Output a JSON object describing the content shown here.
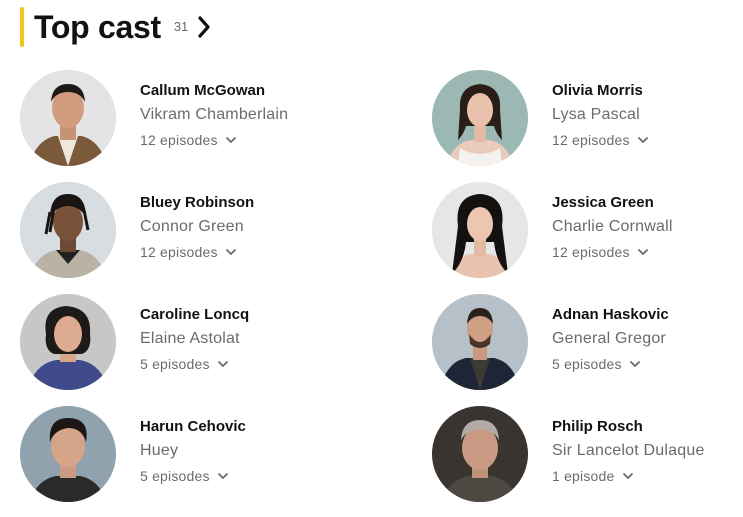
{
  "section": {
    "title": "Top cast",
    "count": "31"
  },
  "colors": {
    "accent": "#f5c518",
    "secondary_text": "#6b6b6b"
  },
  "cast": [
    {
      "actor": "Callum McGowan",
      "character": "Vikram Chamberlain",
      "episodes": "12 episodes"
    },
    {
      "actor": "Olivia Morris",
      "character": "Lysa Pascal",
      "episodes": "12 episodes"
    },
    {
      "actor": "Bluey Robinson",
      "character": "Connor Green",
      "episodes": "12 episodes"
    },
    {
      "actor": "Jessica Green",
      "character": "Charlie Cornwall",
      "episodes": "12 episodes"
    },
    {
      "actor": "Caroline Loncq",
      "character": "Elaine Astolat",
      "episodes": "5 episodes"
    },
    {
      "actor": "Adnan Haskovic",
      "character": "General Gregor",
      "episodes": "5 episodes"
    },
    {
      "actor": "Harun Cehovic",
      "character": "Huey",
      "episodes": "5 episodes"
    },
    {
      "actor": "Philip Rosch",
      "character": "Sir Lancelot Dulaque",
      "episodes": "1 episode"
    }
  ]
}
